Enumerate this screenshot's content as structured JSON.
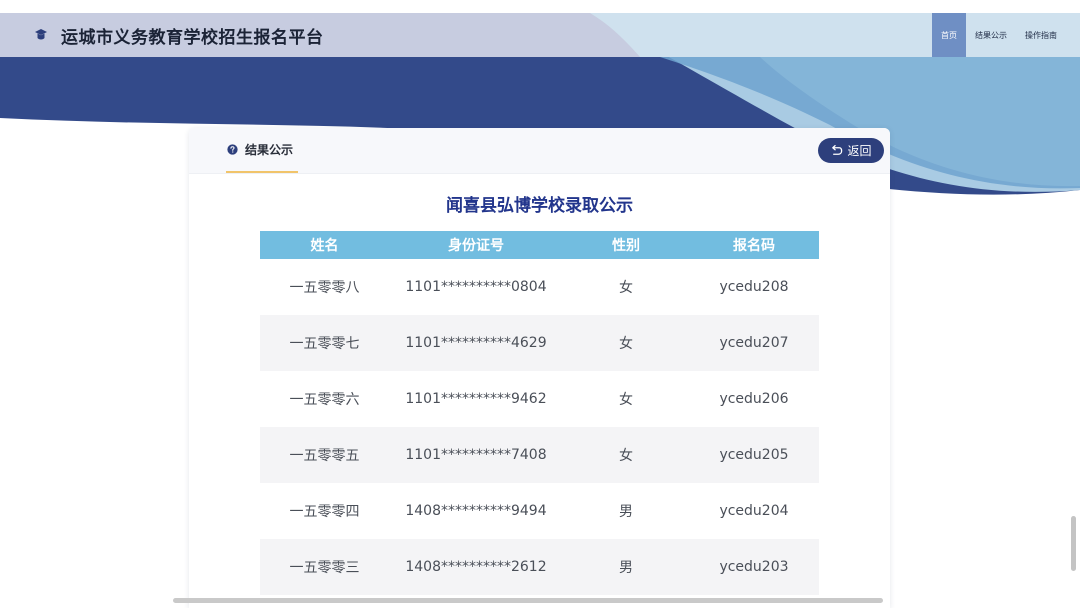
{
  "header": {
    "site_title": "运城市义务教育学校招生报名平台",
    "nav": [
      {
        "label": "首页",
        "active": true
      },
      {
        "label": "结果公示",
        "active": false
      },
      {
        "label": "操作指南",
        "active": false
      }
    ]
  },
  "card": {
    "tab_label": "结果公示",
    "back_label": "返回",
    "title": "闻喜县弘博学校录取公示",
    "columns": [
      "姓名",
      "身份证号",
      "性别",
      "报名码"
    ],
    "rows": [
      [
        "一五零零八",
        "1101**********0804",
        "女",
        "ycedu208"
      ],
      [
        "一五零零七",
        "1101**********4629",
        "女",
        "ycedu207"
      ],
      [
        "一五零零六",
        "1101**********9462",
        "女",
        "ycedu206"
      ],
      [
        "一五零零五",
        "1101**********7408",
        "女",
        "ycedu205"
      ],
      [
        "一五零零四",
        "1408**********9494",
        "男",
        "ycedu204"
      ],
      [
        "一五零零三",
        "1408**********2612",
        "男",
        "ycedu203"
      ]
    ]
  },
  "colors": {
    "header_bar": "#c7cce0",
    "band_dark": "#334a8a",
    "nav_active": "#6f8fc4",
    "table_head": "#72bde0",
    "title_blue": "#22358c",
    "back_button": "#2d3f7c",
    "tab_underline": "#f1c46a"
  },
  "icons": {
    "logo": "graduation-cap-icon",
    "tab": "question-circle-icon",
    "back": "return-arrow-icon"
  }
}
